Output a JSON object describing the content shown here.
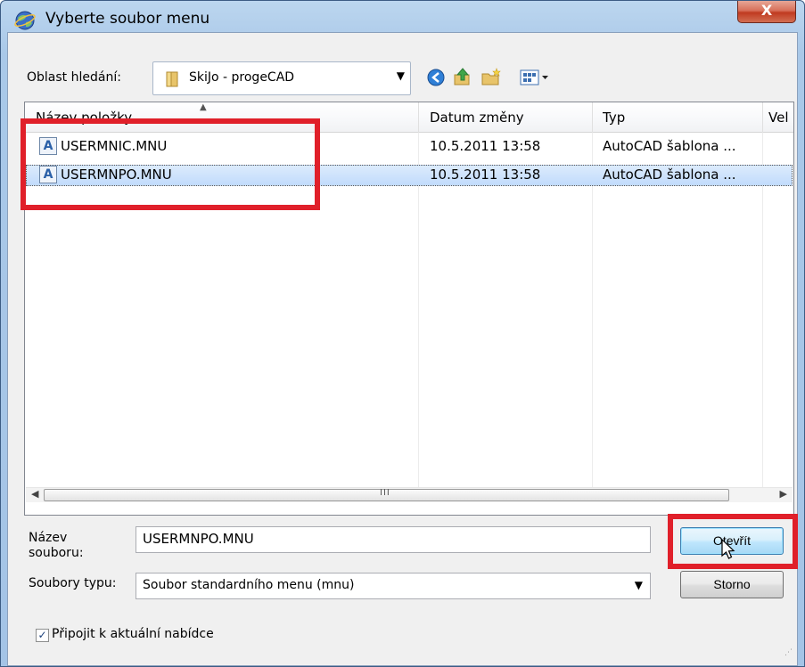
{
  "window": {
    "title": "Vyberte soubor menu",
    "close_label": "X"
  },
  "lookin": {
    "label": "Oblast hledání:",
    "value": "SkiJo - progeCAD"
  },
  "toolbar": {
    "icons": [
      "back-icon",
      "up-folder-icon",
      "new-folder-icon",
      "view-menu-icon"
    ]
  },
  "list": {
    "columns": [
      "Název položky",
      "Datum změny",
      "Typ",
      "Vel"
    ],
    "rows": [
      {
        "name": "USERMNIC.MNU",
        "date": "10.5.2011 13:58",
        "type": "AutoCAD šablona ...",
        "selected": false
      },
      {
        "name": "USERMNPO.MNU",
        "date": "10.5.2011 13:58",
        "type": "AutoCAD šablona ...",
        "selected": true
      }
    ],
    "scroll_grip": "III"
  },
  "filename": {
    "label_line1": "Název",
    "label_line2": "souboru:",
    "value": "USERMNPO.MNU"
  },
  "filetype": {
    "label": "Soubory typu:",
    "value": "Soubor standardního menu (mnu)"
  },
  "buttons": {
    "open_label": "Otevřít",
    "cancel_label": "Storno"
  },
  "append": {
    "label": "Připojit k aktuální nabídce",
    "checked": true
  },
  "colors": {
    "highlight_box": "#e0202a",
    "selection": "#c1dbfc",
    "title_gradient": "#a9c8e8"
  }
}
